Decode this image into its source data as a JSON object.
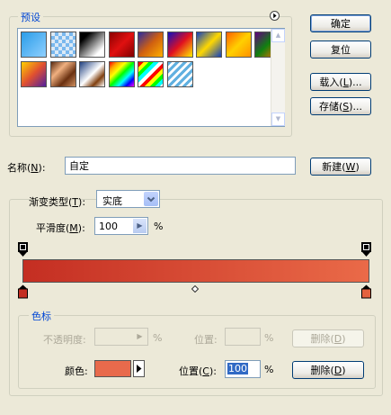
{
  "presets": {
    "title": "预设",
    "swatches": [
      {
        "name": "fg-to-transparent",
        "css": "linear-gradient(135deg,#2a9ce8,#8fd0ff)"
      },
      {
        "name": "transparent-checker",
        "css": "repeating-conic-gradient(#7ab8ee 0% 25%, #dbe9f6 0% 50%) 0 0/8px 8px"
      },
      {
        "name": "black-white",
        "css": "linear-gradient(135deg,#000 20%,#fff 80%)"
      },
      {
        "name": "red-dark",
        "css": "linear-gradient(135deg,#8a0000,#e01010,#800000)"
      },
      {
        "name": "violet-orange",
        "css": "linear-gradient(135deg,#2a2aa0,#d06010,#ffb000)"
      },
      {
        "name": "blue-red-yellow",
        "css": "linear-gradient(135deg,#1010c0,#e01020,#ffee00)"
      },
      {
        "name": "blue-yellow-blue",
        "css": "linear-gradient(135deg,#1040c0,#ffd800,#1040c0)"
      },
      {
        "name": "orange-yellow",
        "css": "linear-gradient(135deg,#ff6000,#ffd000,#ff9000)"
      },
      {
        "name": "violet-green-orange",
        "css": "linear-gradient(135deg,#600080,#108010,#ff7000)"
      },
      {
        "name": "yellow-violet",
        "css": "linear-gradient(135deg,#ffd000,#e05030,#5020a0)"
      },
      {
        "name": "copper",
        "css": "linear-gradient(135deg,#5a2a10,#f0b080,#6a3010,#d09060)"
      },
      {
        "name": "chrome",
        "css": "linear-gradient(135deg,#204080,#ffffff 50%,#804010,#ffffff)"
      },
      {
        "name": "spectrum",
        "css": "linear-gradient(135deg,red,orange,yellow,lime,cyan,blue,magenta)"
      },
      {
        "name": "transparent-rainbow",
        "css": "repeating-linear-gradient(135deg,red 0 4px,yellow 4px 8px,lime 8px 12px,cyan 12px 16px,#fff 16px 20px)"
      },
      {
        "name": "stripes-blue",
        "css": "repeating-linear-gradient(135deg,#60b0e0 0 3px,#ffffff 3px 6px)"
      }
    ]
  },
  "buttons": {
    "ok": "确定",
    "reset": "复位",
    "load": "载入(L)...",
    "load_pre": "载入(",
    "load_key": "L",
    "load_post": ")...",
    "save_pre": "存储(",
    "save_key": "S",
    "save_post": ")...",
    "new_pre": "新建(",
    "new_key": "W",
    "new_post": ")",
    "delete_opacity_pre": "删除(",
    "delete_opacity_key": "D",
    "delete_opacity_post": ")",
    "delete_color_pre": "删除(",
    "delete_color_key": "D",
    "delete_color_post": ")"
  },
  "name_row": {
    "label_pre": "名称(",
    "label_key": "N",
    "label_post": "):",
    "value": "自定"
  },
  "gradient_type": {
    "label_pre": "渐变类型(",
    "label_key": "T",
    "label_post": "):",
    "selected": "实底"
  },
  "smoothness": {
    "label_pre": "平滑度(",
    "label_key": "M",
    "label_post": "):",
    "value": "100",
    "unit": "%"
  },
  "gradient": {
    "start_color": "#c42e22",
    "end_color": "#ea6a48",
    "left_stop_color": "#c42e22",
    "right_stop_color": "#e3623f"
  },
  "stops": {
    "title": "色标",
    "opacity_label": "不透明度:",
    "opacity_unit": "%",
    "opacity_location_label": "位置:",
    "opacity_location_unit": "%",
    "color_label": "颜色:",
    "color_swatch": "#e86a4c",
    "location_label_pre": "位置(",
    "location_label_key": "C",
    "location_label_post": "):",
    "location_value": "100",
    "location_unit": "%"
  }
}
